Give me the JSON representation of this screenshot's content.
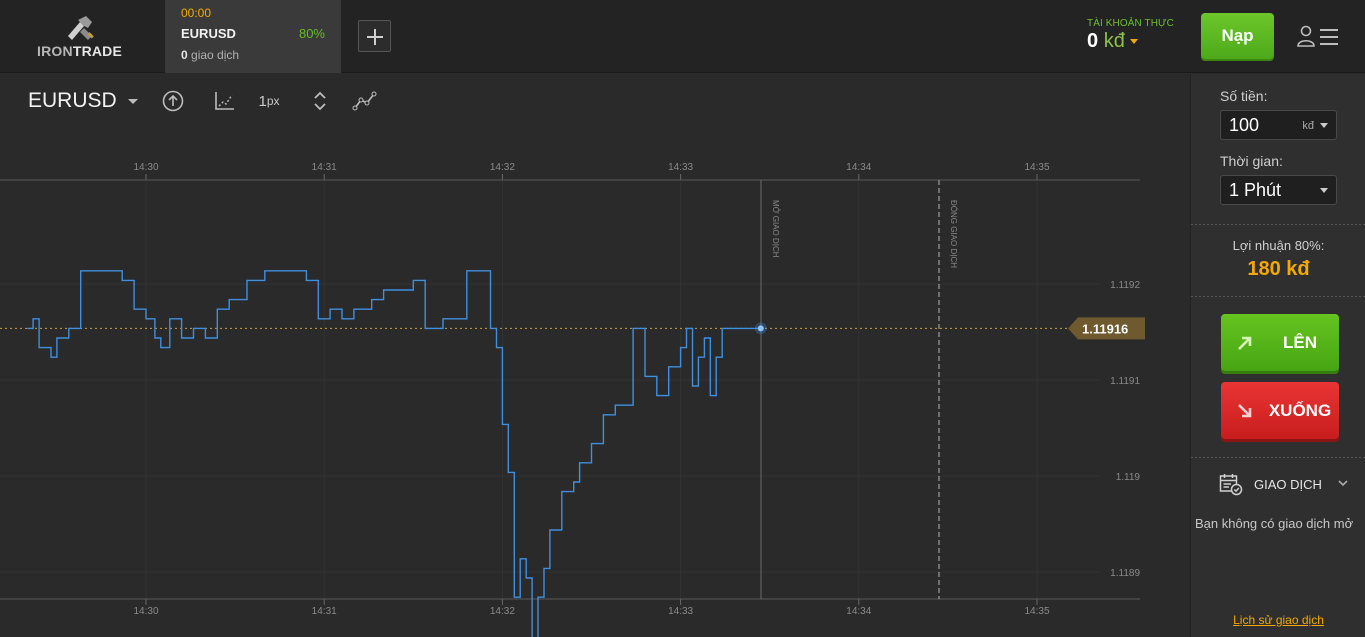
{
  "header": {
    "logo": {
      "iron": "IRON",
      "trade": "TRADE"
    },
    "asset_tab": {
      "time": "00:00",
      "symbol": "EURUSD",
      "payout": "80%",
      "trades_count": "0",
      "trades_label": "giao dịch"
    },
    "account": {
      "label": "TÀI KHOẢN THỰC",
      "balance": "0",
      "currency": "kđ"
    },
    "deposit_label": "Nạp"
  },
  "chart_toolbar": {
    "asset": "EURUSD",
    "pixel_size": "1",
    "pixel_unit": "px"
  },
  "chart_data": {
    "type": "line",
    "x_tick_labels": [
      "14:30",
      "14:31",
      "14:32",
      "14:33",
      "14:34",
      "14:35"
    ],
    "y_tick_labels": [
      "1.1192",
      "1.1191",
      "1.119",
      "1.1189"
    ],
    "current_price": "1.11916",
    "open_label": "MỞ GIAO DỊCH",
    "close_label": "ĐÓNG GIAO DỊCH",
    "series": [
      {
        "points": [
          [
            "14:29:20",
            1.11916
          ],
          [
            "14:29:22",
            1.11917
          ],
          [
            "14:29:24",
            1.11914
          ],
          [
            "14:29:28",
            1.11913
          ],
          [
            "14:29:30",
            1.11915
          ],
          [
            "14:29:34",
            1.11916
          ],
          [
            "14:29:38",
            1.11922
          ],
          [
            "14:29:45",
            1.11922
          ],
          [
            "14:29:52",
            1.11921
          ],
          [
            "14:29:56",
            1.11918
          ],
          [
            "14:30:00",
            1.11917
          ],
          [
            "14:30:03",
            1.11915
          ],
          [
            "14:30:05",
            1.11914
          ],
          [
            "14:30:08",
            1.11917
          ],
          [
            "14:30:12",
            1.11915
          ],
          [
            "14:30:16",
            1.11916
          ],
          [
            "14:30:20",
            1.11915
          ],
          [
            "14:30:24",
            1.11918
          ],
          [
            "14:30:28",
            1.11919
          ],
          [
            "14:30:34",
            1.11921
          ],
          [
            "14:30:40",
            1.11922
          ],
          [
            "14:30:48",
            1.11922
          ],
          [
            "14:30:54",
            1.11921
          ],
          [
            "14:30:58",
            1.11917
          ],
          [
            "14:31:02",
            1.11918
          ],
          [
            "14:31:06",
            1.11917
          ],
          [
            "14:31:10",
            1.11918
          ],
          [
            "14:31:16",
            1.11919
          ],
          [
            "14:31:20",
            1.1192
          ],
          [
            "14:31:26",
            1.1192
          ],
          [
            "14:31:30",
            1.11921
          ],
          [
            "14:31:34",
            1.11916
          ],
          [
            "14:31:40",
            1.11917
          ],
          [
            "14:31:48",
            1.11922
          ],
          [
            "14:31:54",
            1.11922
          ],
          [
            "14:31:56",
            1.11916
          ],
          [
            "14:31:58",
            1.11914
          ],
          [
            "14:32:00",
            1.11906
          ],
          [
            "14:32:02",
            1.11901
          ],
          [
            "14:32:04",
            1.11888
          ],
          [
            "14:32:06",
            1.11892
          ],
          [
            "14:32:08",
            1.1189
          ],
          [
            "14:32:10",
            1.11883
          ],
          [
            "14:32:12",
            1.11888
          ],
          [
            "14:32:14",
            1.11891
          ],
          [
            "14:32:16",
            1.11895
          ],
          [
            "14:32:20",
            1.11899
          ],
          [
            "14:32:24",
            1.119
          ],
          [
            "14:32:26",
            1.11902
          ],
          [
            "14:32:30",
            1.11904
          ],
          [
            "14:32:34",
            1.11907
          ],
          [
            "14:32:38",
            1.11908
          ],
          [
            "14:32:42",
            1.11908
          ],
          [
            "14:32:44",
            1.11916
          ],
          [
            "14:32:48",
            1.11911
          ],
          [
            "14:32:52",
            1.11909
          ],
          [
            "14:32:56",
            1.11912
          ],
          [
            "14:33:00",
            1.11914
          ],
          [
            "14:33:02",
            1.11916
          ],
          [
            "14:33:04",
            1.1191
          ],
          [
            "14:33:06",
            1.11913
          ],
          [
            "14:33:08",
            1.11915
          ],
          [
            "14:33:10",
            1.11909
          ],
          [
            "14:33:12",
            1.11913
          ],
          [
            "14:33:14",
            1.11916
          ],
          [
            "14:33:27",
            1.11916
          ]
        ]
      }
    ]
  },
  "panel": {
    "amount_label": "Số tiền:",
    "amount_value": "100",
    "amount_unit": "kđ",
    "time_label": "Thời gian:",
    "time_value": "1 Phút",
    "profit_label": "Lợi nhuận 80%:",
    "profit_value": "180 kđ",
    "up_label": "LÊN",
    "down_label": "XUỐNG",
    "trades_title": "GIAO DỊCH",
    "no_trades": "Bạn không có giao dịch mở",
    "history_link": "Lịch sử giao dịch"
  },
  "colors": {
    "line": "#3f8fe0",
    "up": "#5bbd1c",
    "down": "#d92727",
    "accent": "#f4a900",
    "price_tag": "#6e5a2e"
  }
}
